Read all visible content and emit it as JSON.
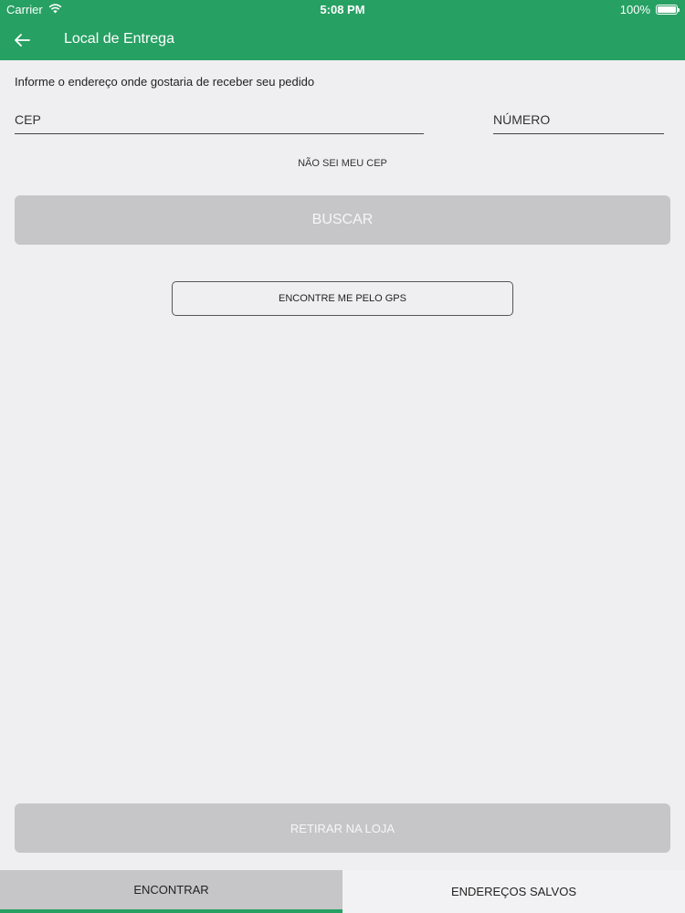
{
  "status_bar": {
    "carrier": "Carrier",
    "time": "5:08 PM",
    "battery_text": "100%",
    "battery_level_percent": 100
  },
  "app_bar": {
    "back_icon": "arrow-left-icon",
    "title": "Local de Entrega"
  },
  "form": {
    "instruction": "Informe o endereço onde gostaria de receber seu pedido",
    "cep": {
      "placeholder": "CEP",
      "value": ""
    },
    "numero": {
      "placeholder": "NÚMERO",
      "value": ""
    },
    "dont_know_cep": "NÃO SEI MEU CEP",
    "search_button": "BUSCAR",
    "gps_button": "ENCONTRE ME PELO GPS"
  },
  "pickup_button": "RETIRAR NA LOJA",
  "tabs": [
    {
      "label": "ENCONTRAR",
      "active": true
    },
    {
      "label": "ENDEREÇOS SALVOS",
      "active": false
    }
  ],
  "colors": {
    "primary": "#27a063",
    "background": "#efeff1",
    "disabled_button": "#c6c5c8",
    "disabled_text": "#f7f7f7"
  }
}
